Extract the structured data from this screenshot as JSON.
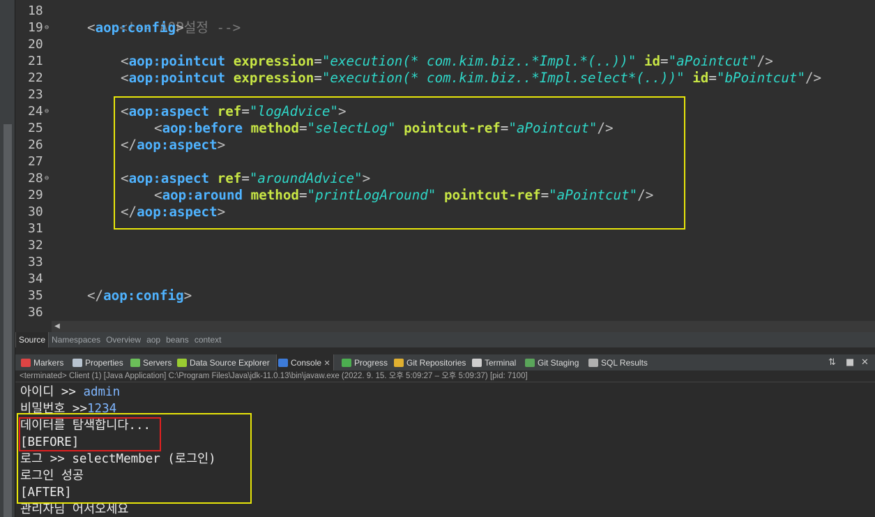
{
  "editor": {
    "lines": [
      {
        "num": "18",
        "fold": false
      },
      {
        "num": "19",
        "fold": true
      },
      {
        "num": "20",
        "fold": false
      },
      {
        "num": "21",
        "fold": false
      },
      {
        "num": "22",
        "fold": false
      },
      {
        "num": "23",
        "fold": false
      },
      {
        "num": "24",
        "fold": true
      },
      {
        "num": "25",
        "fold": false
      },
      {
        "num": "26",
        "fold": false
      },
      {
        "num": "27",
        "fold": false
      },
      {
        "num": "28",
        "fold": true
      },
      {
        "num": "29",
        "fold": false
      },
      {
        "num": "30",
        "fold": false
      },
      {
        "num": "31",
        "fold": false
      },
      {
        "num": "32",
        "fold": false
      },
      {
        "num": "33",
        "fold": false
      },
      {
        "num": "34",
        "fold": false
      },
      {
        "num": "35",
        "fold": false
      },
      {
        "num": "36",
        "fold": false
      }
    ],
    "comment": "<!-- AOP설정 -->",
    "t_config": "aop:config",
    "t_pointcut": "aop:pointcut",
    "t_aspect": "aop:aspect",
    "t_before": "aop:before",
    "t_around": "aop:around",
    "a_expression": "expression",
    "a_id": "id",
    "a_ref": "ref",
    "a_method": "method",
    "a_pointcut_ref": "pointcut-ref",
    "v_expr_a": "\"execution(* com.kim.biz..*Impl.*(..))\"",
    "v_id_a": "\"aPointcut\"",
    "v_expr_b": "\"execution(* com.kim.biz..*Impl.select*(..))\"",
    "v_id_b": "\"bPointcut\"",
    "v_log_advice": "\"logAdvice\"",
    "v_select_log": "\"selectLog\"",
    "v_pref_a": "\"aPointcut\"",
    "v_around_advice": "\"aroundAdvice\"",
    "v_print_log_around": "\"printLogAround\""
  },
  "editor_tabs": [
    "Source",
    "Namespaces",
    "Overview",
    "aop",
    "beans",
    "context"
  ],
  "views": [
    {
      "label": "Markers",
      "icon": "markers-icon",
      "color": "#d44"
    },
    {
      "label": "Properties",
      "icon": "properties-icon",
      "color": "#b8c4d0"
    },
    {
      "label": "Servers",
      "icon": "servers-icon",
      "color": "#6bbf59"
    },
    {
      "label": "Data Source Explorer",
      "icon": "data-source-icon",
      "color": "#9acd32"
    },
    {
      "label": "Console",
      "icon": "console-icon",
      "color": "#3d7bd9",
      "active": true
    },
    {
      "label": "Progress",
      "icon": "progress-icon",
      "color": "#4caf50"
    },
    {
      "label": "Git Repositories",
      "icon": "git-repositories-icon",
      "color": "#e0b030"
    },
    {
      "label": "Terminal",
      "icon": "terminal-icon",
      "color": "#cfcfcf"
    },
    {
      "label": "Git Staging",
      "icon": "git-staging-icon",
      "color": "#5aa55a"
    },
    {
      "label": "SQL Results",
      "icon": "sql-results-icon",
      "color": "#b0b0b0"
    }
  ],
  "console": {
    "info": "<terminated> Client (1) [Java Application] C:\\Program Files\\Java\\jdk-11.0.13\\bin\\javaw.exe  (2022. 9. 15. 오후 5:09:27 – 오후 5:09:37) [pid: 7100]",
    "id_prompt": "아이디 >> ",
    "id_input": "admin",
    "pw_prompt": "비밀번호 >>",
    "pw_input": "1234",
    "lines": [
      "데이터를 탐색합니다...",
      "[BEFORE]",
      "로그 >> selectMember (로그인)",
      "로그인 성공",
      "[AFTER]",
      "관리자님 어서오세요"
    ]
  }
}
